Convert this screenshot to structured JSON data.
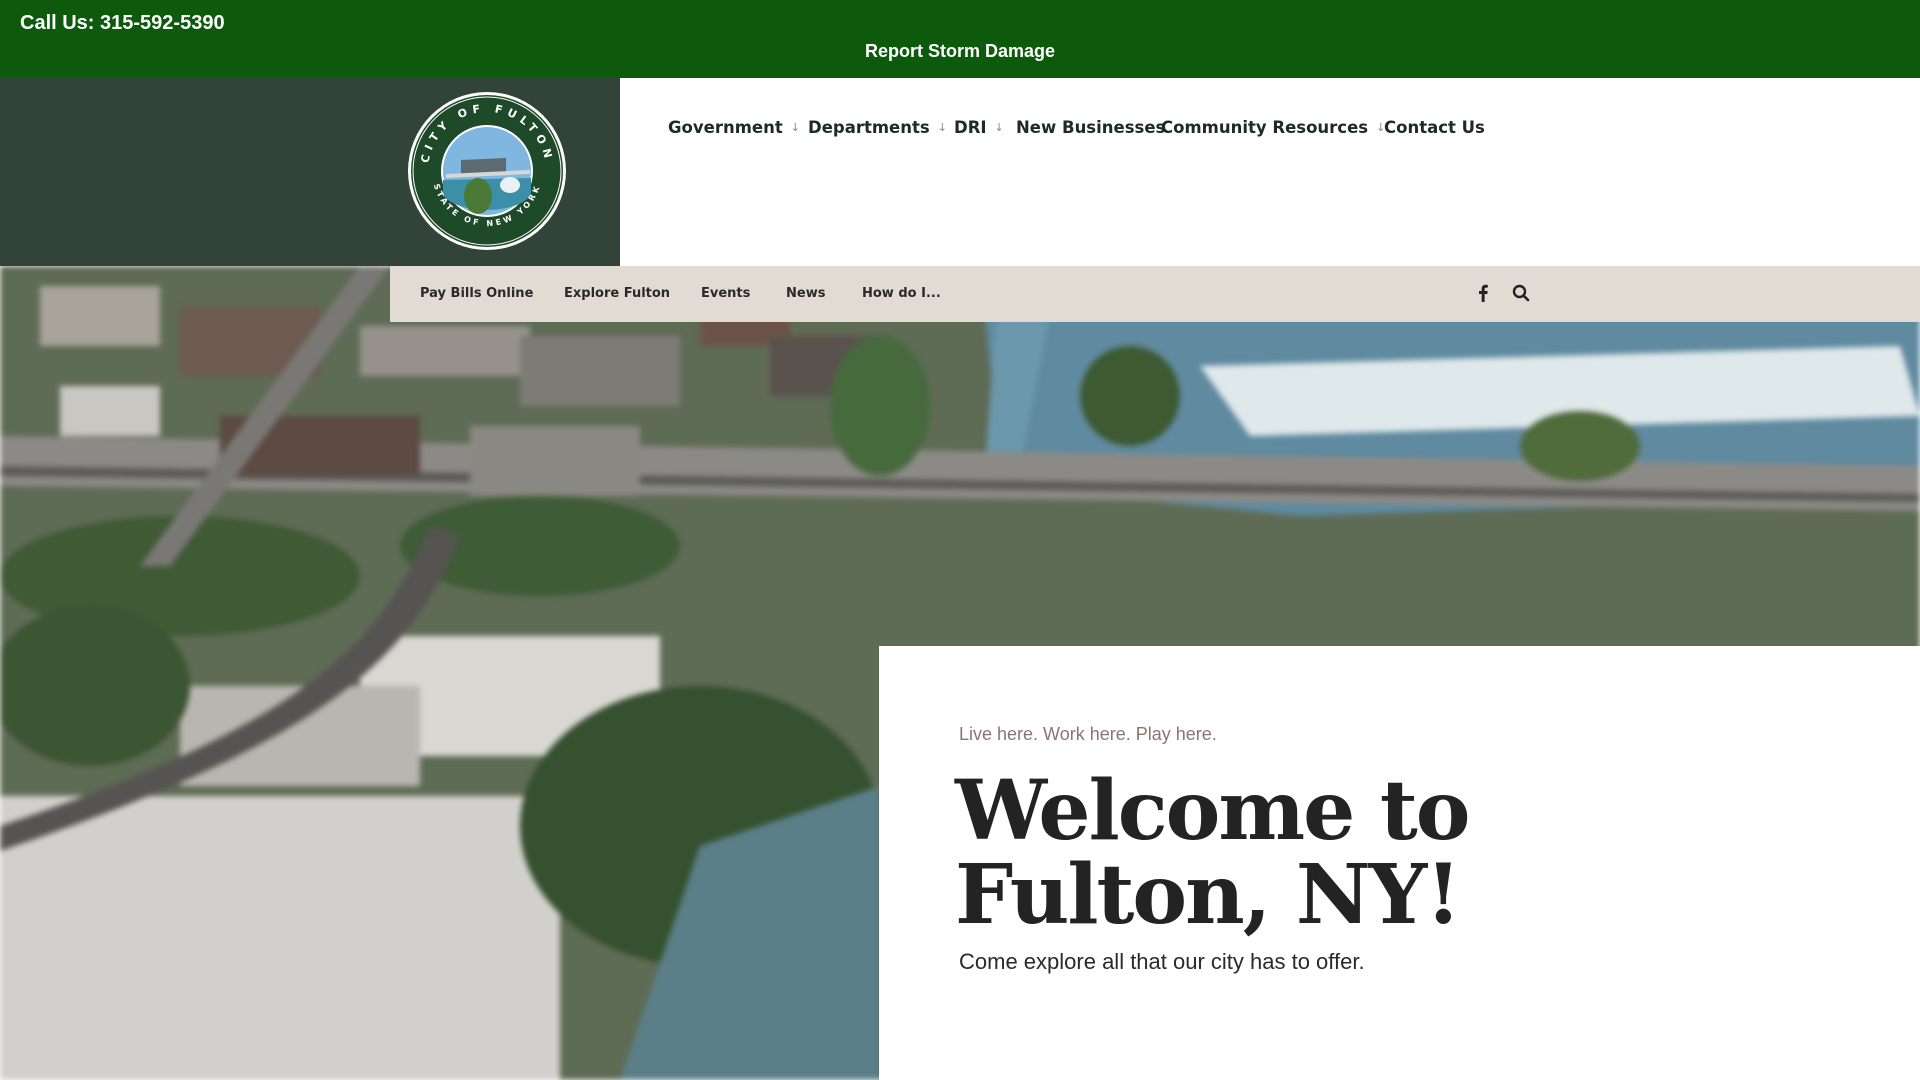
{
  "topbar": {
    "call_label": "Call Us: 315-592-5390",
    "storm_link": "Report Storm Damage",
    "bg_color": "#0e5a0c"
  },
  "header": {
    "seal_top_text": "CITY OF FULTON",
    "seal_bottom_text": "STATE OF NEW YORK",
    "panel_color": "#324339"
  },
  "main_nav": [
    {
      "label": "Government",
      "dropdown": true
    },
    {
      "label": "Departments",
      "dropdown": true
    },
    {
      "label": "DRI",
      "dropdown": true
    },
    {
      "label": "New Businesses",
      "dropdown": false
    },
    {
      "label": "Community Resources",
      "dropdown": true
    },
    {
      "label": "Contact Us",
      "dropdown": false
    }
  ],
  "dropdown_arrow": "↓",
  "sub_nav": {
    "items": [
      "Pay Bills Online",
      "Explore Fulton",
      "Events",
      "News",
      "How do I..."
    ],
    "icons": [
      "facebook-icon",
      "search-icon"
    ],
    "bg_color": "#e2dbd4"
  },
  "hero": {
    "tagline": "Live here. Work here. Play here.",
    "title": "Welcome to Fulton, NY!",
    "subtitle": "Come explore all that our city has to offer."
  }
}
